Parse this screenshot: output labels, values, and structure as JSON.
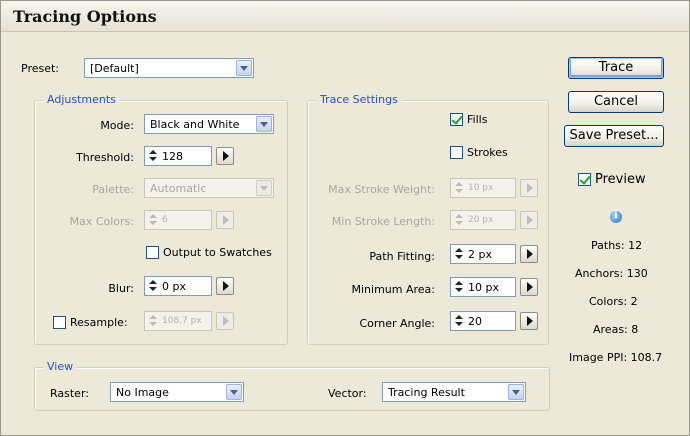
{
  "window": {
    "title": "Tracing Options"
  },
  "preset": {
    "label": "Preset:",
    "value": "[Default]"
  },
  "adjustments": {
    "title": "Adjustments",
    "mode": {
      "label": "Mode:",
      "value": "Black and White"
    },
    "threshold": {
      "label": "Threshold:",
      "value": "128"
    },
    "palette": {
      "label": "Palette:",
      "value": "Automatic"
    },
    "max_colors": {
      "label": "Max Colors:",
      "value": "6"
    },
    "output_to_swatches": {
      "label": "Output to Swatches",
      "checked": false
    },
    "blur": {
      "label": "Blur:",
      "value": "0 px"
    },
    "resample": {
      "label": "Resample:",
      "value": "108.7 px",
      "checked": false
    }
  },
  "trace_settings": {
    "title": "Trace Settings",
    "fills": {
      "label": "Fills",
      "checked": true
    },
    "strokes": {
      "label": "Strokes",
      "checked": false
    },
    "max_stroke_weight": {
      "label": "Max Stroke Weight:",
      "value": "10 px"
    },
    "min_stroke_length": {
      "label": "Min Stroke Length:",
      "value": "20 px"
    },
    "path_fitting": {
      "label": "Path Fitting:",
      "value": "2 px"
    },
    "minimum_area": {
      "label": "Minimum Area:",
      "value": "10 px"
    },
    "corner_angle": {
      "label": "Corner Angle:",
      "value": "20"
    }
  },
  "view": {
    "title": "View",
    "raster": {
      "label": "Raster:",
      "value": "No Image"
    },
    "vector": {
      "label": "Vector:",
      "value": "Tracing Result"
    }
  },
  "buttons": {
    "trace": "Trace",
    "cancel": "Cancel",
    "save_preset": "Save Preset..."
  },
  "preview": {
    "label": "Preview",
    "checked": true
  },
  "stats": {
    "paths": "Paths: 12",
    "anchors": "Anchors: 130",
    "colors": "Colors: 2",
    "areas": "Areas: 8",
    "image_ppi": "Image PPI: 108.7"
  },
  "colors": {
    "group_title": "#2b4fc0",
    "dialog_bg": "#ece9d8",
    "field_border": "#7f9db9"
  }
}
